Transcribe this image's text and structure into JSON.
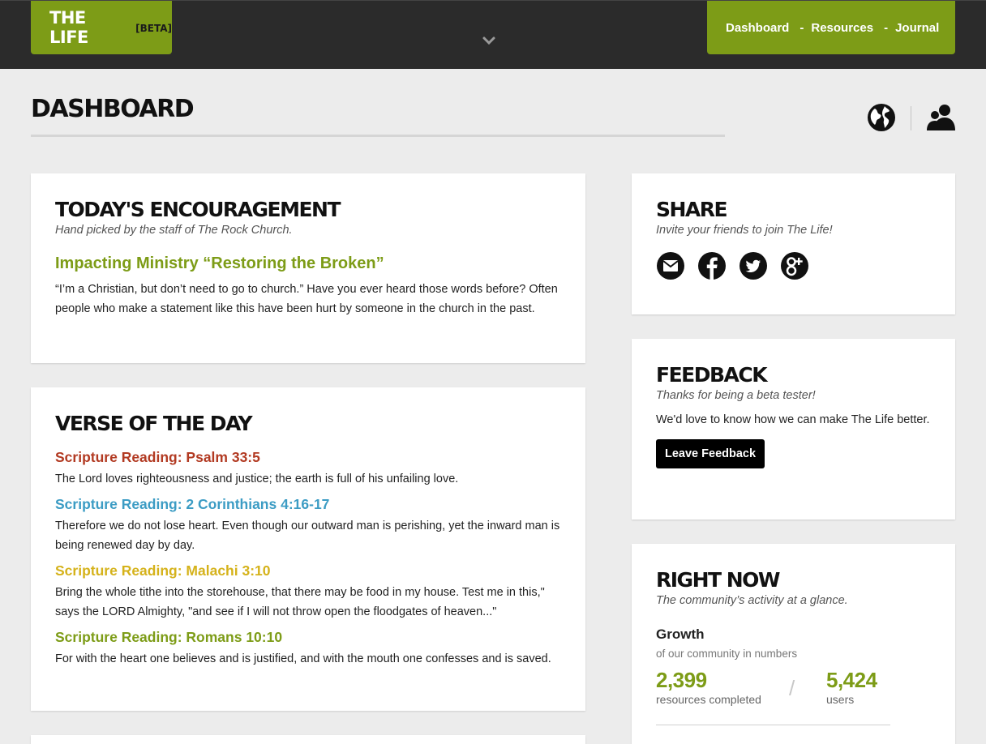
{
  "header": {
    "logo_text": "THE LIFE",
    "logo_badge": "[BETA]",
    "nav": [
      {
        "label": "Dashboard"
      },
      {
        "label": "Resources"
      },
      {
        "label": "Journal"
      }
    ],
    "nav_separator": "-"
  },
  "page": {
    "title": "DASHBOARD",
    "icons": [
      "globe-icon",
      "user-icon"
    ]
  },
  "encouragement": {
    "heading": "TODAY'S ENCOURAGEMENT",
    "subtitle": "Hand picked by the staff of The Rock Church.",
    "article_title": "Impacting Ministry “Restoring the Broken”",
    "article_body": "“I’m a Christian, but don’t need to go to church.” Have you ever heard those words before? Often people who make a statement like this have been hurt by someone in the church in the past."
  },
  "verse": {
    "heading": "VERSE OF THE DAY",
    "items": [
      {
        "title": "Scripture Reading: Psalm 33:5",
        "color": "#b23a22",
        "text": "The Lord loves righteousness and justice; the earth is full of his unfailing love."
      },
      {
        "title": "Scripture Reading: 2 Corinthians 4:16-17",
        "color": "#3c9cc4",
        "text": "Therefore we do not lose heart. Even though our outward man is perishing, yet the inward man is being renewed day by day."
      },
      {
        "title": "Scripture Reading: Malachi 3:10",
        "color": "#d5b21a",
        "text": "Bring the whole tithe into the storehouse, that there may be food in my house. Test me in this,\" says the LORD Almighty, \"and see if I will not throw open the floodgates of heaven...\""
      },
      {
        "title": "Scripture Reading: Romans 10:10",
        "color": "#7d9c17",
        "text": "For with the heart one believes and is justified, and with the mouth one confesses and is saved."
      }
    ]
  },
  "share": {
    "heading": "SHARE",
    "subtitle": "Invite your friends to join The Life!",
    "icons": [
      "email-icon",
      "facebook-icon",
      "twitter-icon",
      "google-plus-icon"
    ]
  },
  "feedback": {
    "heading": "FEEDBACK",
    "subtitle": "Thanks for being a beta tester!",
    "body": "We'd love to know how we can make The Life better.",
    "button": "Leave Feedback"
  },
  "right_now": {
    "heading": "RIGHT NOW",
    "subtitle": "The community’s activity at a glance.",
    "growth_title": "Growth",
    "growth_subtitle": "of our community in numbers",
    "stats": [
      {
        "value": "2,399",
        "label": "resources completed"
      },
      {
        "value": "5,424",
        "label": "users"
      }
    ],
    "stat_separator": "/"
  },
  "colors": {
    "brand_green": "#7d9c17",
    "topbar": "#2b2b2b",
    "background": "#ececec"
  }
}
